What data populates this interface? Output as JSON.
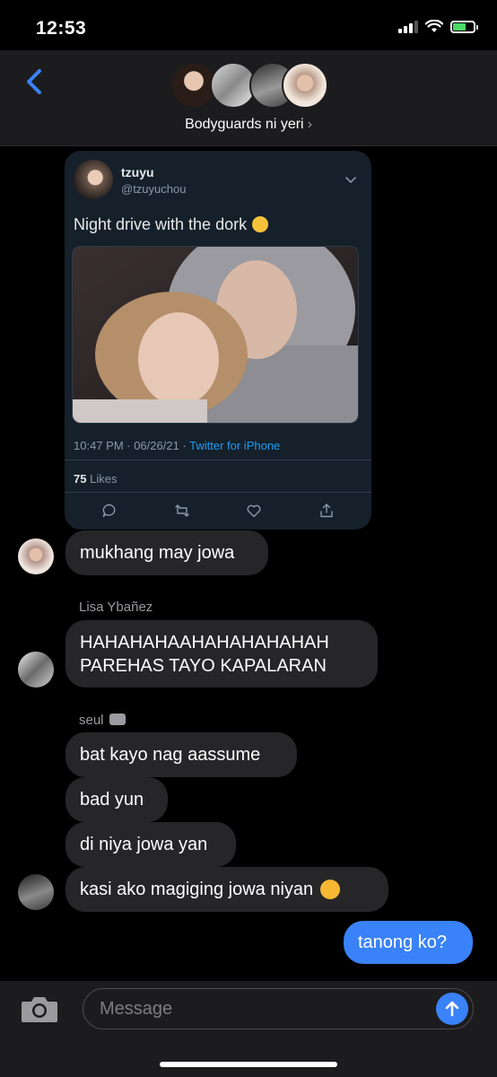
{
  "status_bar": {
    "time": "12:53",
    "icons": [
      "signal-icon",
      "wifi-icon",
      "battery-charging-icon"
    ],
    "battery_color": "#4cd964"
  },
  "header": {
    "group_name": "Bodyguards ni yeri",
    "chevron": "›",
    "back_icon": "chevron-left-icon",
    "accent": "#3a82f7"
  },
  "tweet": {
    "name": "tzuyu",
    "handle": "@tzuyuchou",
    "text": "Night drive with the dork",
    "emoji": "rolling-eyes-emoji",
    "time": "10:47 PM · 06/26/21 · ",
    "source": "Twitter for iPhone",
    "likes_count": "75",
    "likes_label": "Likes",
    "source_color": "#1d9bf0"
  },
  "messages": [
    {
      "text": "mukhang may jowa",
      "direction": "in"
    },
    {
      "sender": "Lisa Ybañez",
      "text": "HAHAHAHAAHAHAHAHAHAH PAREHAS TAYO KAPALARAN",
      "direction": "in"
    },
    {
      "sender": "seul",
      "text": "bat kayo nag aassume",
      "direction": "in"
    },
    {
      "text": "bad yun",
      "direction": "in"
    },
    {
      "text": "di niya jowa yan",
      "direction": "in"
    },
    {
      "text": "kasi ako magiging jowa niyan",
      "direction": "in",
      "emoji": "smiling-face-with-hearts-emoji"
    },
    {
      "text": "tanong ko?",
      "direction": "out"
    }
  ],
  "composer": {
    "placeholder": "Message",
    "camera_icon": "camera-icon",
    "send_icon": "arrow-up-icon"
  }
}
